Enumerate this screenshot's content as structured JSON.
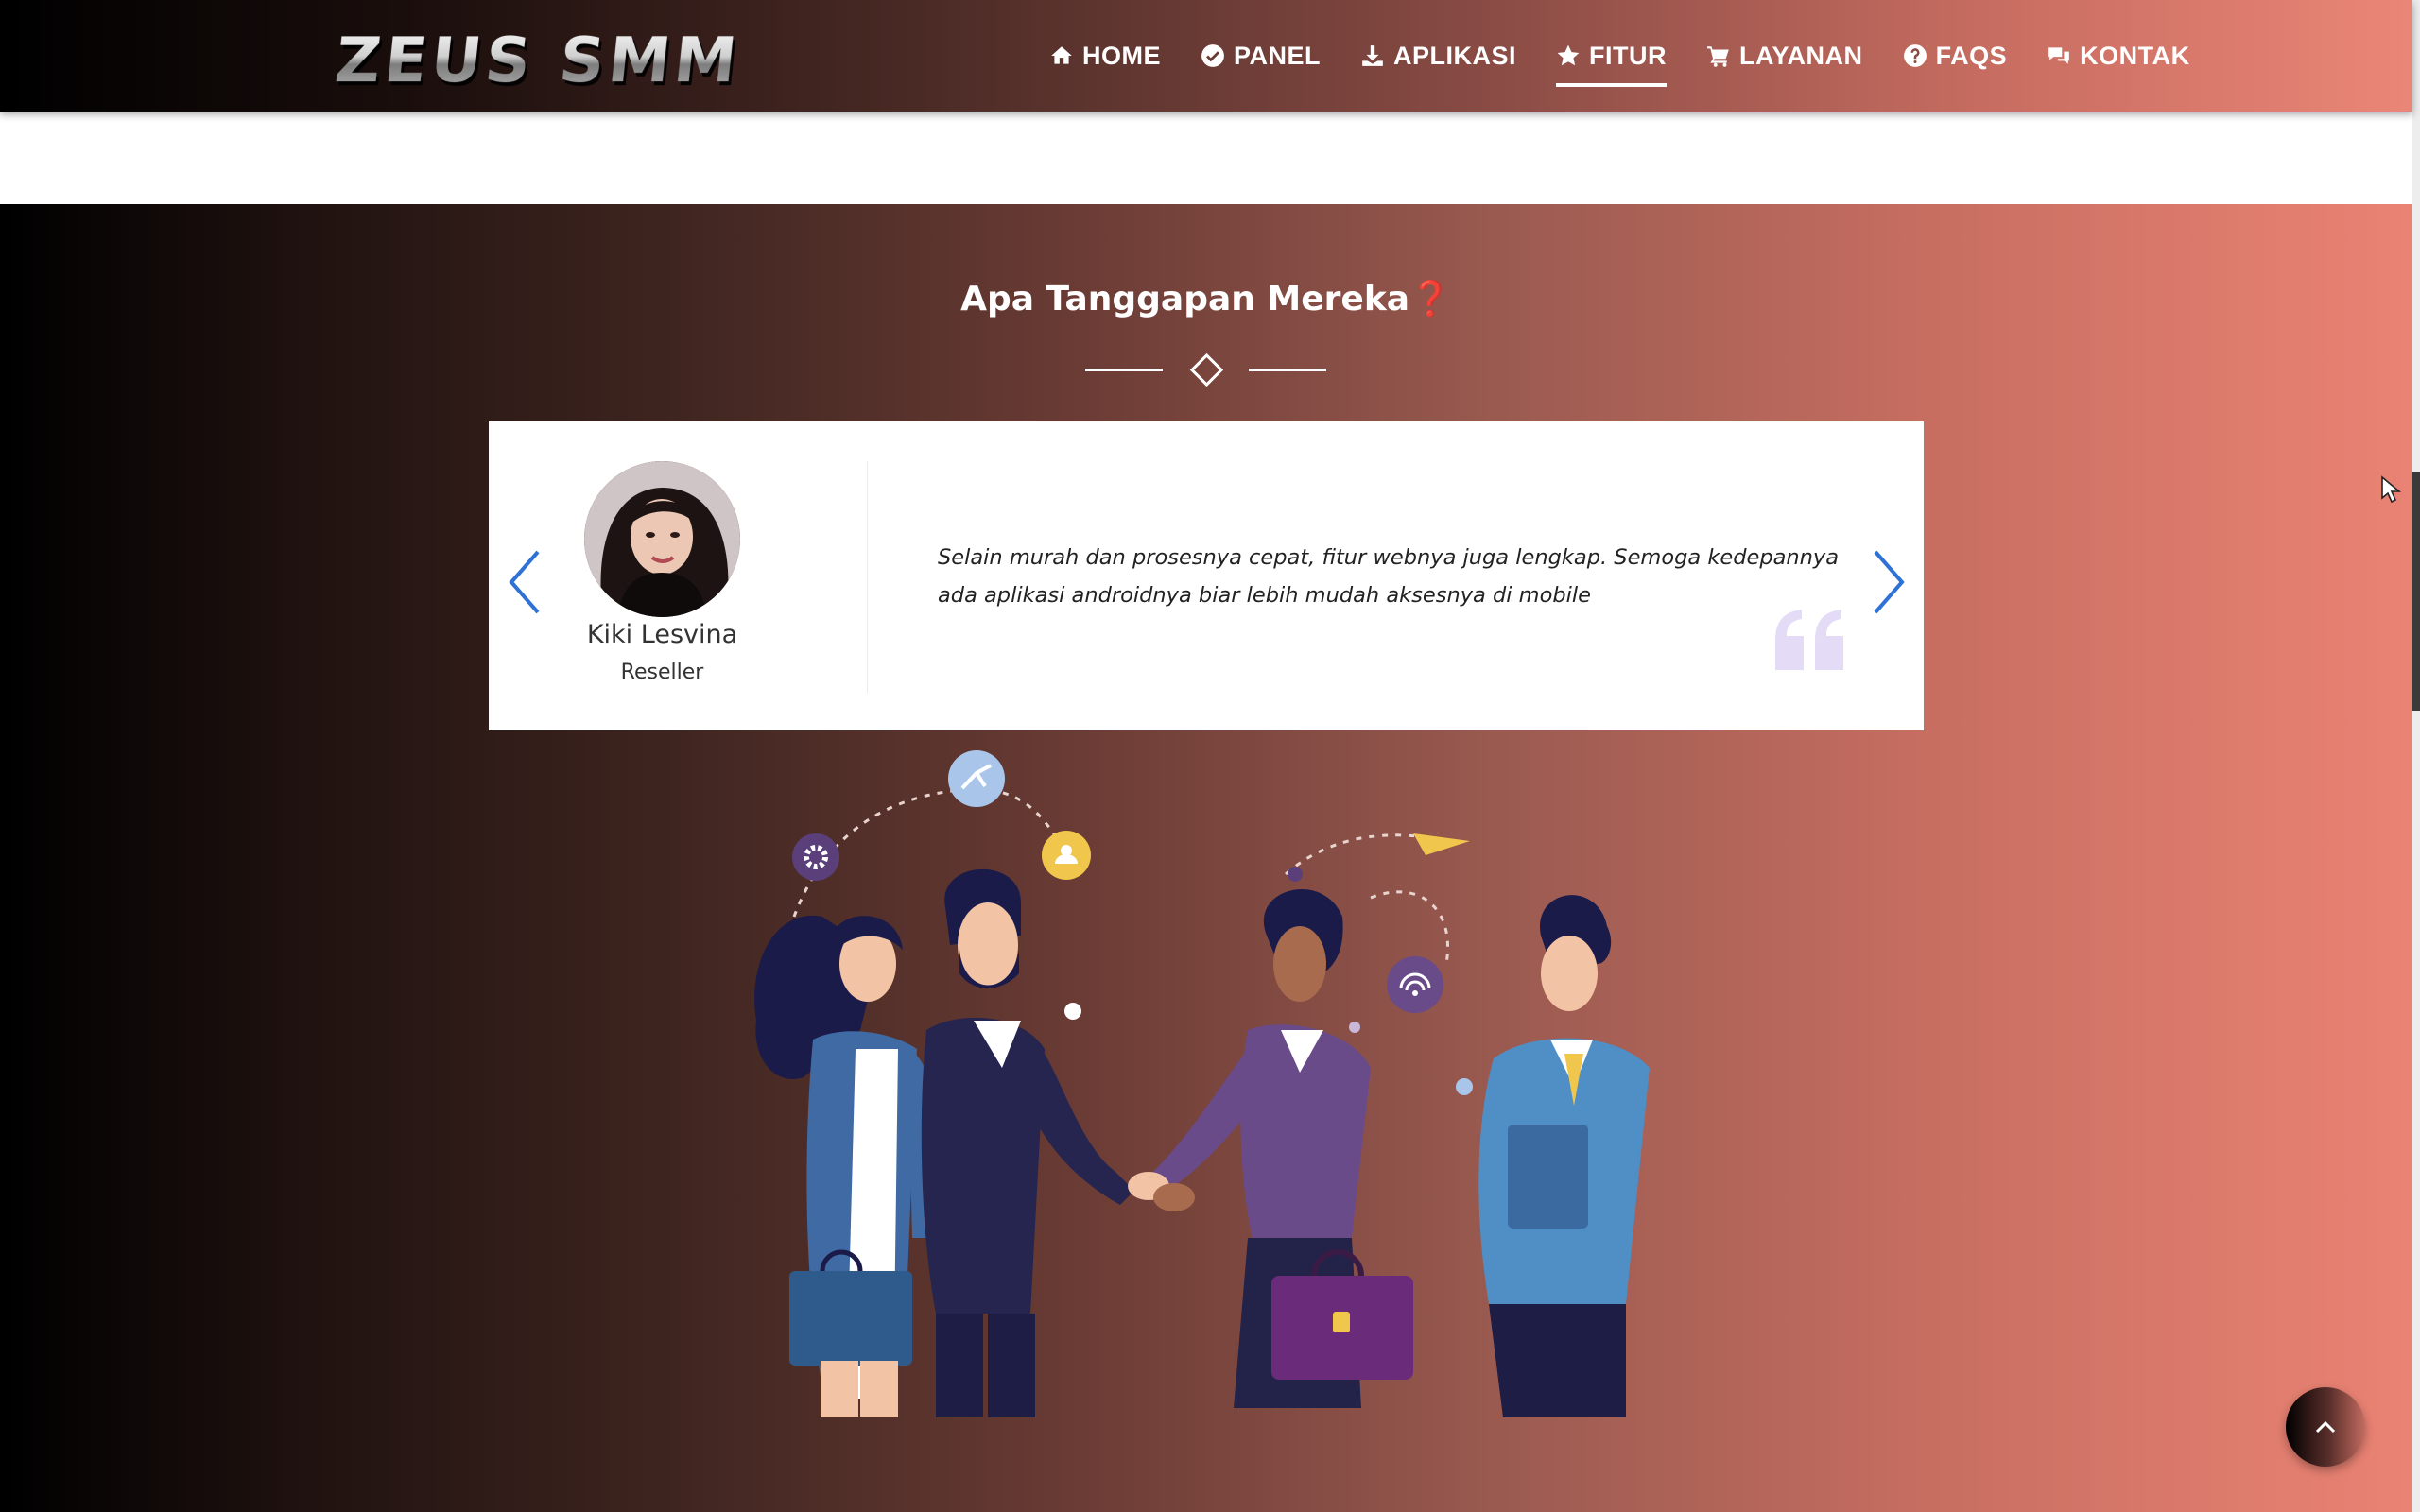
{
  "brand": {
    "logo_text": "ZEUS SMM"
  },
  "nav": {
    "items": [
      {
        "label": "HOME",
        "icon": "home-icon",
        "active": false
      },
      {
        "label": "PANEL",
        "icon": "check-circle-icon",
        "active": false
      },
      {
        "label": "APLIKASI",
        "icon": "download-icon",
        "active": false
      },
      {
        "label": "FITUR",
        "icon": "star-icon",
        "active": true
      },
      {
        "label": "LAYANAN",
        "icon": "cart-icon",
        "active": false
      },
      {
        "label": "FAQS",
        "icon": "question-circle-icon",
        "active": false
      },
      {
        "label": "KONTAK",
        "icon": "comments-icon",
        "active": false
      }
    ]
  },
  "testimonials": {
    "title": "Apa Tanggapan Mereka❓",
    "current": {
      "name": "Kiki Lesvina",
      "role": "Reseller",
      "quote": "Selain murah dan prosesnya cepat, fitur webnya juga lengkap. Semoga kedepannya ada aplikasi androidnya biar lebih mudah aksesnya di mobile"
    }
  },
  "colors": {
    "gradient_start": "#000000",
    "gradient_end": "#ea8374",
    "arrow_blue": "#2f72d6",
    "quote_icon": "#e4dcf6"
  }
}
